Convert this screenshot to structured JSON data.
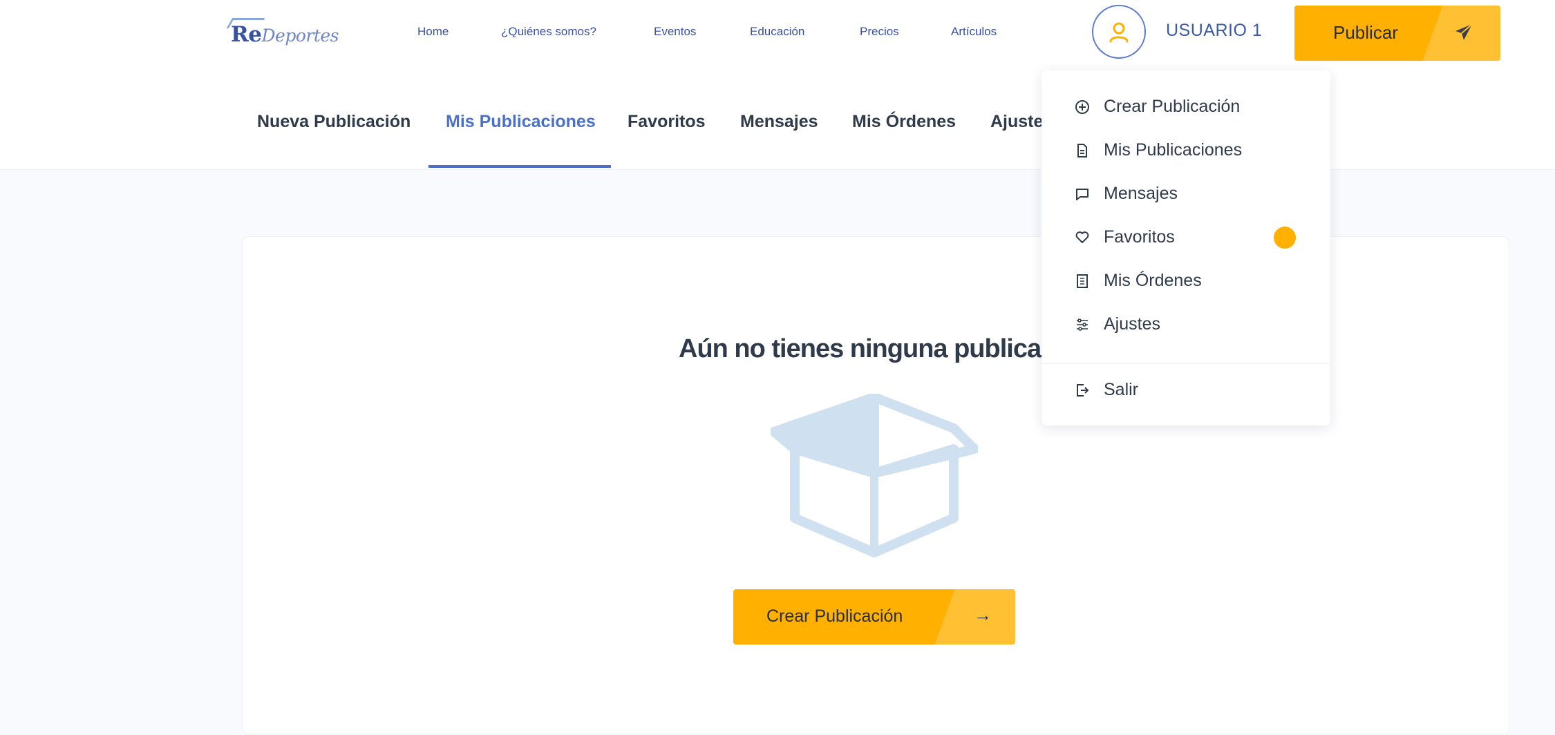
{
  "header": {
    "logo_re": "Re",
    "logo_rest": "Deportes",
    "nav": [
      "Home",
      "¿Quiénes somos?",
      "Eventos",
      "Educación",
      "Precios",
      "Artículos"
    ],
    "user_name": "USUARIO 1",
    "publish_label": "Publicar"
  },
  "tabs": [
    "Nueva Publicación",
    "Mis Publicaciones",
    "Favoritos",
    "Mensajes",
    "Mis Órdenes",
    "Ajuste"
  ],
  "active_tab": "Mis Publicaciones",
  "main": {
    "empty_title": "Aún no tienes ninguna publicaci",
    "create_label": "Crear Publicación",
    "create_arrow": "→"
  },
  "dropdown": {
    "items": [
      {
        "label": "Crear Publicación",
        "icon": "plus-circle-icon"
      },
      {
        "label": "Mis Publicaciones",
        "icon": "document-icon"
      },
      {
        "label": "Mensajes",
        "icon": "message-icon"
      },
      {
        "label": "Favoritos",
        "icon": "heart-icon"
      },
      {
        "label": "Mis Órdenes",
        "icon": "list-icon"
      },
      {
        "label": "Ajustes",
        "icon": "sliders-icon"
      }
    ],
    "logout_label": "Salir"
  },
  "colors": {
    "accent": "#ffb000",
    "brand": "#4a70c7",
    "text": "#2f3a4a"
  }
}
